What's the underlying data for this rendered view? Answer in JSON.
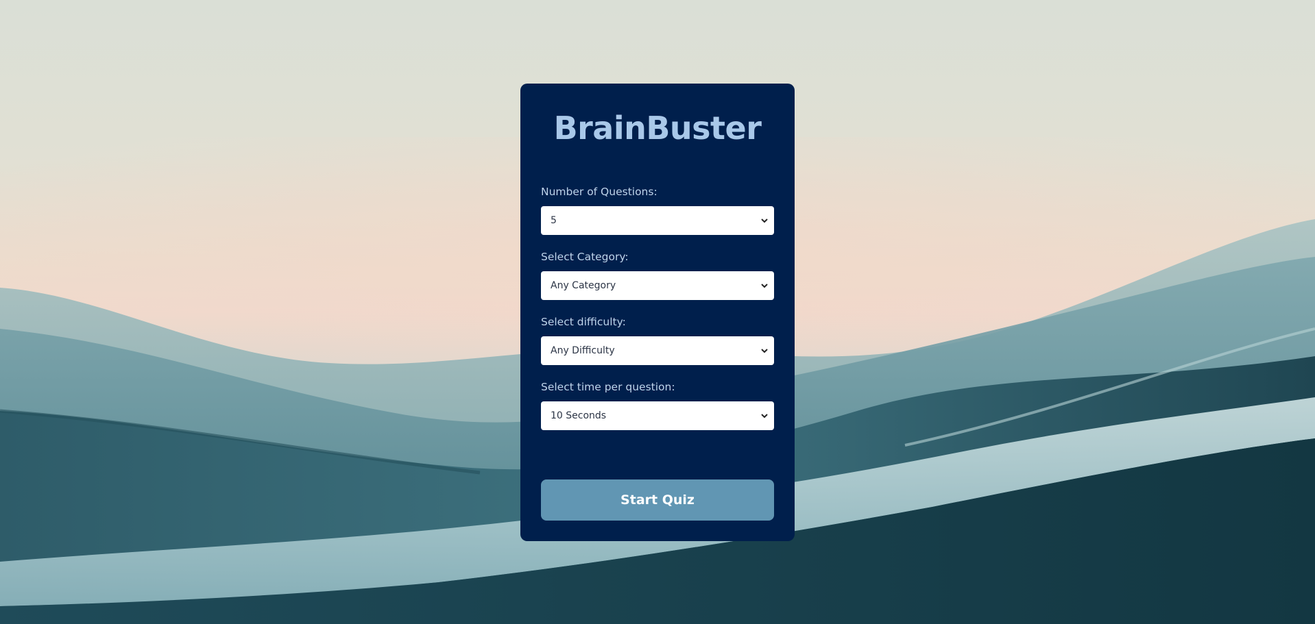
{
  "app": {
    "title": "BrainBuster"
  },
  "form": {
    "questions": {
      "label": "Number of Questions:",
      "value": "5"
    },
    "category": {
      "label": "Select Category:",
      "value": "Any Category"
    },
    "difficulty": {
      "label": "Select difficulty:",
      "value": "Any Difficulty"
    },
    "time": {
      "label": "Select time per question:",
      "value": "10 Seconds"
    }
  },
  "actions": {
    "start_label": "Start Quiz"
  },
  "colors": {
    "card_background": "#001f4c",
    "title": "#a9c8e9",
    "button": "#6196b3",
    "label": "#bfd3ea"
  },
  "icons": {
    "select_arrow": "chevron-down-icon"
  }
}
